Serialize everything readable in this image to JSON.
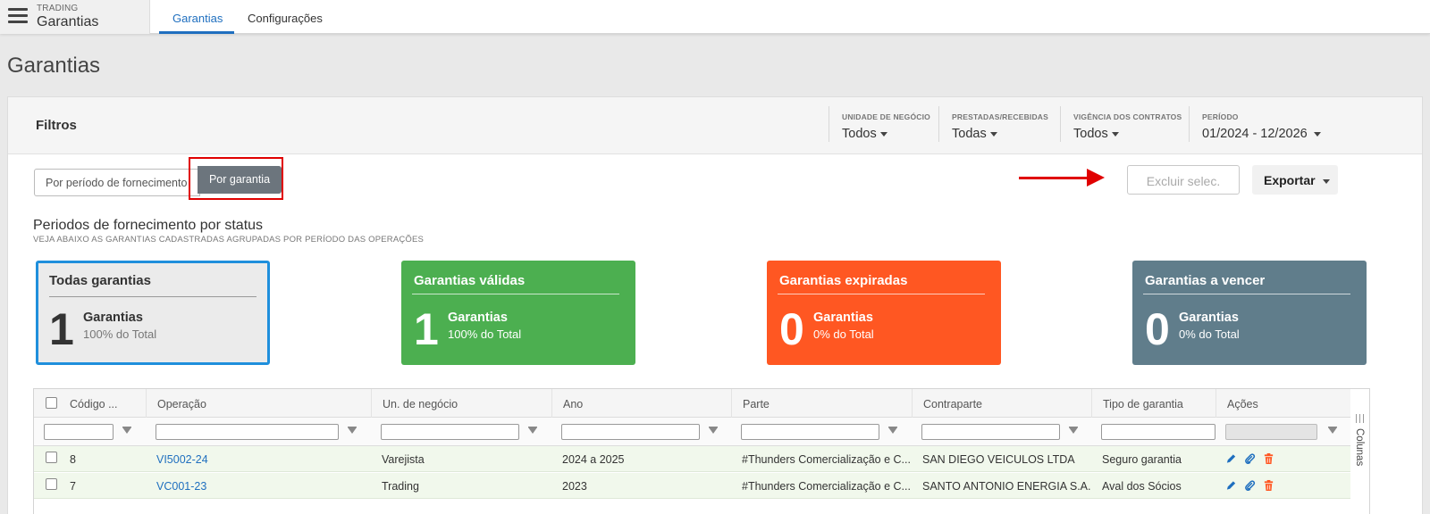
{
  "app": {
    "module": "TRADING",
    "title": "Garantias"
  },
  "tabs": [
    {
      "label": "Garantias",
      "active": true
    },
    {
      "label": "Configurações",
      "active": false
    }
  ],
  "page_title": "Garantias",
  "filters": {
    "title": "Filtros",
    "unidade": {
      "label": "UNIDADE DE NEGÓCIO",
      "value": "Todos"
    },
    "prestadas": {
      "label": "PRESTADAS/RECEBIDAS",
      "value": "Todas"
    },
    "vigencia": {
      "label": "VIGÊNCIA DOS CONTRATOS",
      "value": "Todos"
    },
    "periodo": {
      "label": "PERÍODO",
      "value": "01/2024 - 12/2026"
    }
  },
  "view_toggle": {
    "by_period": "Por período de fornecimento",
    "by_guarantee": "Por garantia",
    "selected": "Por garantia"
  },
  "actions": {
    "delete_selected": "Excluir selec.",
    "export": "Exportar"
  },
  "section": {
    "title": "Periodos de fornecimento por status",
    "subtitle": "VEJA ABAIXO AS GARANTIAS CADASTRADAS AGRUPADAS POR PERÍODO DAS OPERAÇÕES"
  },
  "cards": [
    {
      "title": "Todas garantias",
      "count": "1",
      "label": "Garantias",
      "percent": "100% do Total",
      "color": "#ebebeb"
    },
    {
      "title": "Garantias válidas",
      "count": "1",
      "label": "Garantias",
      "percent": "100% do Total",
      "color": "#4caf50"
    },
    {
      "title": "Garantias expiradas",
      "count": "0",
      "label": "Garantias",
      "percent": "0% do Total",
      "color": "#ff5722"
    },
    {
      "title": "Garantias a vencer",
      "count": "0",
      "label": "Garantias",
      "percent": "0% do Total",
      "color": "#607d8b"
    }
  ],
  "grid": {
    "columns": [
      "Código ...",
      "Operação",
      "Un. de negócio",
      "Ano",
      "Parte",
      "Contraparte",
      "Tipo de garantia",
      "Ações"
    ],
    "rows": [
      {
        "codigo": "8",
        "operacao": "VI5002-24",
        "unidade": "Varejista",
        "ano": "2024 a 2025",
        "parte": "#Thunders Comercialização e C...",
        "contraparte": "SAN DIEGO VEICULOS LTDA",
        "tipo": "Seguro garantia"
      },
      {
        "codigo": "7",
        "operacao": "VC001-23",
        "unidade": "Trading",
        "ano": "2023",
        "parte": "#Thunders Comercialização e C...",
        "contraparte": "SANTO ANTONIO ENERGIA S.A.",
        "tipo": "Aval dos Sócios"
      }
    ],
    "side_panel": "Colunas"
  },
  "colors": {
    "accent": "#1f6fbf",
    "highlight_red": "#e00000",
    "row_bg": "#f1f8ec",
    "edit_icon": "#1f6fbf",
    "delete_icon": "#ff5722"
  }
}
